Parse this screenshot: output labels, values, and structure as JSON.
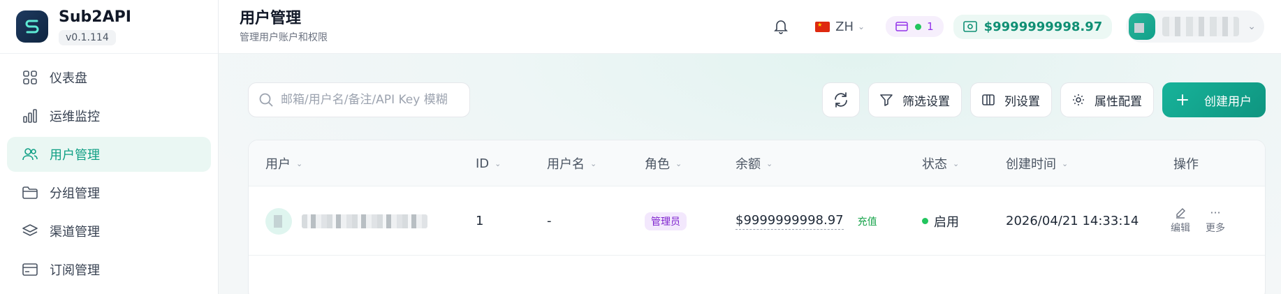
{
  "brand": {
    "name": "Sub2API",
    "version": "v0.1.114"
  },
  "sidebar": {
    "items": [
      {
        "label": "仪表盘",
        "icon": "grid-icon",
        "active": false
      },
      {
        "label": "运维监控",
        "icon": "bar-chart-icon",
        "active": false
      },
      {
        "label": "用户管理",
        "icon": "users-icon",
        "active": true
      },
      {
        "label": "分组管理",
        "icon": "folder-icon",
        "active": false
      },
      {
        "label": "渠道管理",
        "icon": "layers-icon",
        "active": false
      },
      {
        "label": "订阅管理",
        "icon": "credit-card-icon",
        "active": false
      }
    ]
  },
  "header": {
    "title": "用户管理",
    "subtitle": "管理用户账户和权限",
    "language": "ZH",
    "subscription_count": "1",
    "balance": "$9999999998.97"
  },
  "search": {
    "placeholder": "邮箱/用户名/备注/API Key 模糊"
  },
  "toolbar": {
    "filter_label": "筛选设置",
    "columns_label": "列设置",
    "attributes_label": "属性配置",
    "create_label": "创建用户"
  },
  "table": {
    "columns": [
      "用户",
      "ID",
      "用户名",
      "角色",
      "余额",
      "状态",
      "创建时间",
      "操作"
    ],
    "rows": [
      {
        "id": "1",
        "username": "-",
        "role": "管理员",
        "balance": "$9999999998.97",
        "recharge": "充值",
        "status": "启用",
        "created": "2026/04/21 14:33:14",
        "edit": "编辑",
        "more": "更多"
      }
    ]
  },
  "colors": {
    "accent": "#10a08a",
    "active_bg": "#eaf7f3",
    "role_badge": "#f3e8fd",
    "status_ok": "#22c55e"
  }
}
